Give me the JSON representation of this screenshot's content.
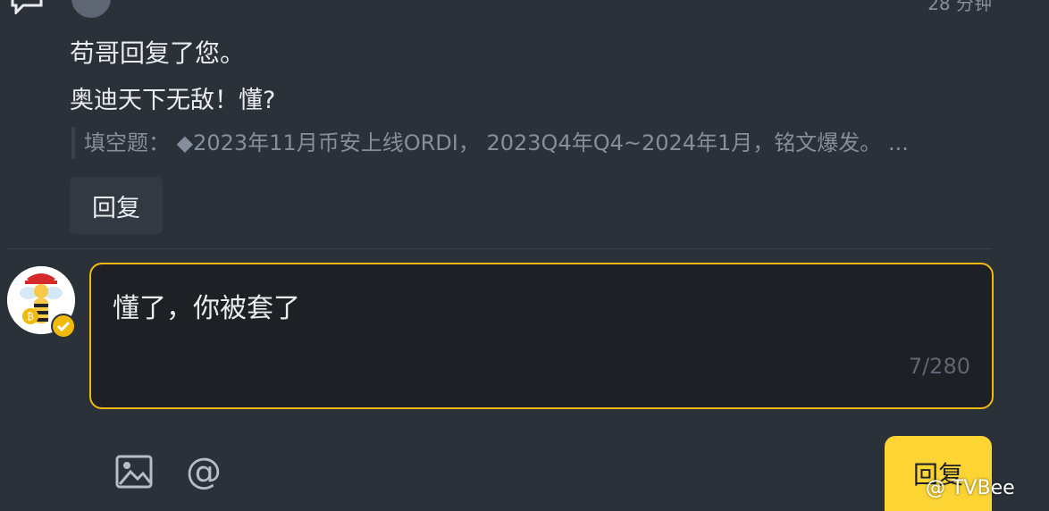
{
  "header": {
    "timestamp": "28 分钟"
  },
  "notification": {
    "title": "苟哥回复了您。",
    "reply_text": "奥迪天下无敌！懂?",
    "quote_text": "填空题： ◆2023年11月币安上线ORDI， 2023Q4年Q4~2024年1月，铭文爆发。 ...",
    "reply_button": "回复"
  },
  "composer": {
    "text": "懂了，你被套了",
    "counter": "7/280",
    "image_icon": "image-icon",
    "mention_icon": "@",
    "submit_label": "回复"
  },
  "watermark": "@ TVBee",
  "colors": {
    "background": "#2b3139",
    "accent": "#f0b90b",
    "button_yellow": "#fcd535"
  }
}
